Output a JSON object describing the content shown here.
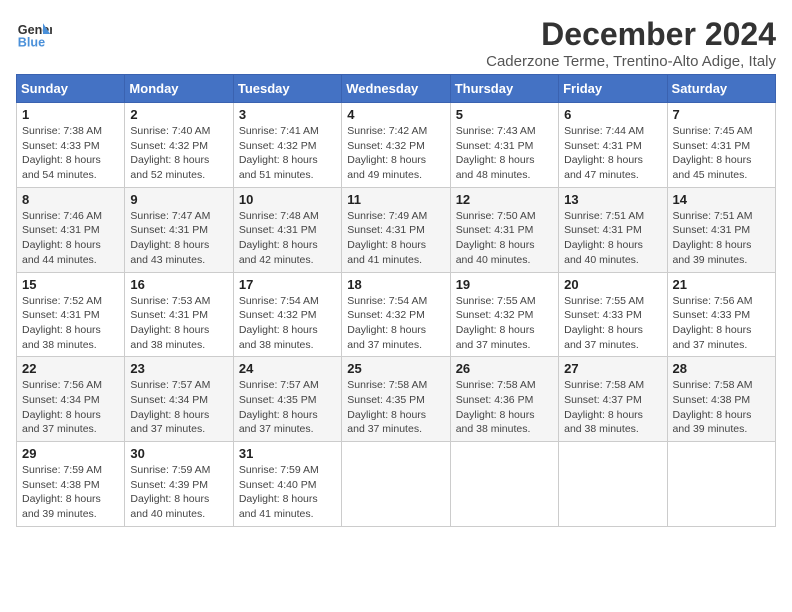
{
  "logo": {
    "line1": "General",
    "line2": "Blue"
  },
  "title": "December 2024",
  "subtitle": "Caderzone Terme, Trentino-Alto Adige, Italy",
  "weekdays": [
    "Sunday",
    "Monday",
    "Tuesday",
    "Wednesday",
    "Thursday",
    "Friday",
    "Saturday"
  ],
  "weeks": [
    [
      {
        "day": "1",
        "info": "Sunrise: 7:38 AM\nSunset: 4:33 PM\nDaylight: 8 hours\nand 54 minutes."
      },
      {
        "day": "2",
        "info": "Sunrise: 7:40 AM\nSunset: 4:32 PM\nDaylight: 8 hours\nand 52 minutes."
      },
      {
        "day": "3",
        "info": "Sunrise: 7:41 AM\nSunset: 4:32 PM\nDaylight: 8 hours\nand 51 minutes."
      },
      {
        "day": "4",
        "info": "Sunrise: 7:42 AM\nSunset: 4:32 PM\nDaylight: 8 hours\nand 49 minutes."
      },
      {
        "day": "5",
        "info": "Sunrise: 7:43 AM\nSunset: 4:31 PM\nDaylight: 8 hours\nand 48 minutes."
      },
      {
        "day": "6",
        "info": "Sunrise: 7:44 AM\nSunset: 4:31 PM\nDaylight: 8 hours\nand 47 minutes."
      },
      {
        "day": "7",
        "info": "Sunrise: 7:45 AM\nSunset: 4:31 PM\nDaylight: 8 hours\nand 45 minutes."
      }
    ],
    [
      {
        "day": "8",
        "info": "Sunrise: 7:46 AM\nSunset: 4:31 PM\nDaylight: 8 hours\nand 44 minutes."
      },
      {
        "day": "9",
        "info": "Sunrise: 7:47 AM\nSunset: 4:31 PM\nDaylight: 8 hours\nand 43 minutes."
      },
      {
        "day": "10",
        "info": "Sunrise: 7:48 AM\nSunset: 4:31 PM\nDaylight: 8 hours\nand 42 minutes."
      },
      {
        "day": "11",
        "info": "Sunrise: 7:49 AM\nSunset: 4:31 PM\nDaylight: 8 hours\nand 41 minutes."
      },
      {
        "day": "12",
        "info": "Sunrise: 7:50 AM\nSunset: 4:31 PM\nDaylight: 8 hours\nand 40 minutes."
      },
      {
        "day": "13",
        "info": "Sunrise: 7:51 AM\nSunset: 4:31 PM\nDaylight: 8 hours\nand 40 minutes."
      },
      {
        "day": "14",
        "info": "Sunrise: 7:51 AM\nSunset: 4:31 PM\nDaylight: 8 hours\nand 39 minutes."
      }
    ],
    [
      {
        "day": "15",
        "info": "Sunrise: 7:52 AM\nSunset: 4:31 PM\nDaylight: 8 hours\nand 38 minutes."
      },
      {
        "day": "16",
        "info": "Sunrise: 7:53 AM\nSunset: 4:31 PM\nDaylight: 8 hours\nand 38 minutes."
      },
      {
        "day": "17",
        "info": "Sunrise: 7:54 AM\nSunset: 4:32 PM\nDaylight: 8 hours\nand 38 minutes."
      },
      {
        "day": "18",
        "info": "Sunrise: 7:54 AM\nSunset: 4:32 PM\nDaylight: 8 hours\nand 37 minutes."
      },
      {
        "day": "19",
        "info": "Sunrise: 7:55 AM\nSunset: 4:32 PM\nDaylight: 8 hours\nand 37 minutes."
      },
      {
        "day": "20",
        "info": "Sunrise: 7:55 AM\nSunset: 4:33 PM\nDaylight: 8 hours\nand 37 minutes."
      },
      {
        "day": "21",
        "info": "Sunrise: 7:56 AM\nSunset: 4:33 PM\nDaylight: 8 hours\nand 37 minutes."
      }
    ],
    [
      {
        "day": "22",
        "info": "Sunrise: 7:56 AM\nSunset: 4:34 PM\nDaylight: 8 hours\nand 37 minutes."
      },
      {
        "day": "23",
        "info": "Sunrise: 7:57 AM\nSunset: 4:34 PM\nDaylight: 8 hours\nand 37 minutes."
      },
      {
        "day": "24",
        "info": "Sunrise: 7:57 AM\nSunset: 4:35 PM\nDaylight: 8 hours\nand 37 minutes."
      },
      {
        "day": "25",
        "info": "Sunrise: 7:58 AM\nSunset: 4:35 PM\nDaylight: 8 hours\nand 37 minutes."
      },
      {
        "day": "26",
        "info": "Sunrise: 7:58 AM\nSunset: 4:36 PM\nDaylight: 8 hours\nand 38 minutes."
      },
      {
        "day": "27",
        "info": "Sunrise: 7:58 AM\nSunset: 4:37 PM\nDaylight: 8 hours\nand 38 minutes."
      },
      {
        "day": "28",
        "info": "Sunrise: 7:58 AM\nSunset: 4:38 PM\nDaylight: 8 hours\nand 39 minutes."
      }
    ],
    [
      {
        "day": "29",
        "info": "Sunrise: 7:59 AM\nSunset: 4:38 PM\nDaylight: 8 hours\nand 39 minutes."
      },
      {
        "day": "30",
        "info": "Sunrise: 7:59 AM\nSunset: 4:39 PM\nDaylight: 8 hours\nand 40 minutes."
      },
      {
        "day": "31",
        "info": "Sunrise: 7:59 AM\nSunset: 4:40 PM\nDaylight: 8 hours\nand 41 minutes."
      },
      {
        "day": "",
        "info": ""
      },
      {
        "day": "",
        "info": ""
      },
      {
        "day": "",
        "info": ""
      },
      {
        "day": "",
        "info": ""
      }
    ]
  ]
}
